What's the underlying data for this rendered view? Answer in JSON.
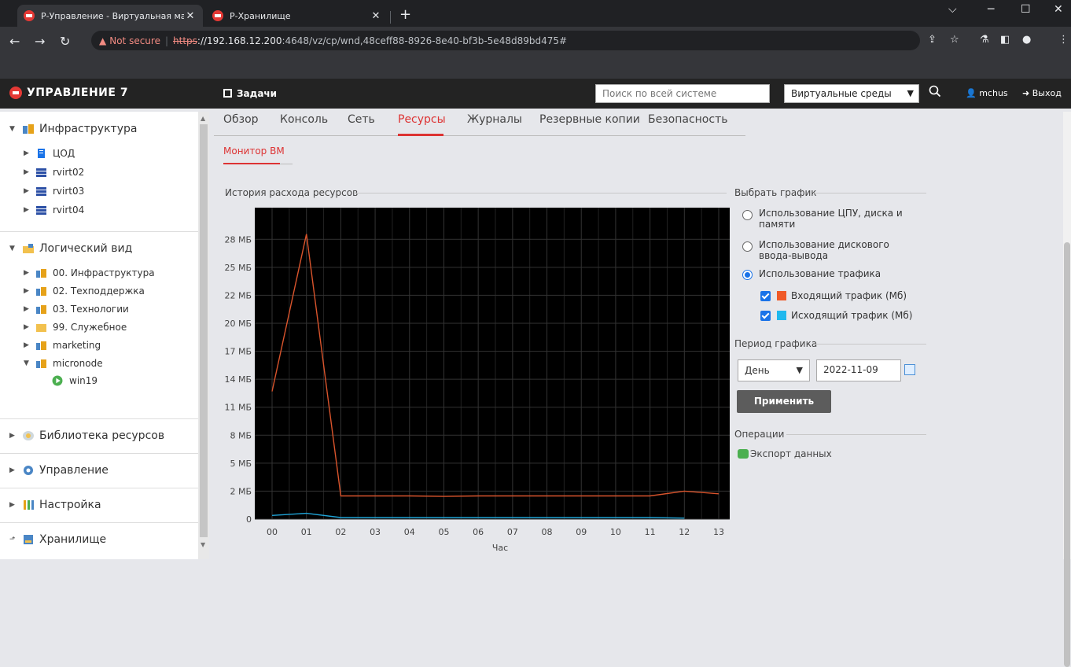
{
  "browser": {
    "tabs": [
      {
        "title": "Р-Управление - Виртуальная ма",
        "close": "✕"
      },
      {
        "title": "Р-Хранилище",
        "close": "✕"
      }
    ],
    "new_tab": "+",
    "url": {
      "warning_label": "Not secure",
      "protocol": "https",
      "host": "://192.168.12.200",
      "path": ":4648/vz/cp/wnd,48ceff88-8926-8e40-bf3b-5e48d89bd475#"
    }
  },
  "header": {
    "logo": "УПРАВЛЕНИЕ 7",
    "tasks_label": "Задачи",
    "search_placeholder": "Поиск по всей системе",
    "env_select": "Виртуальные среды",
    "user": "mchus",
    "logout": "Выход"
  },
  "sidebar": {
    "infrastructure": {
      "label": "Инфраструктура",
      "items": [
        "ЦОД",
        "rvirt02",
        "rvirt03",
        "rvirt04"
      ]
    },
    "logical": {
      "label": "Логический вид",
      "items": [
        "00. Инфраструктура",
        "02. Техподдержка",
        "03. Технологии",
        "99. Служебное",
        "marketing",
        "micronode"
      ],
      "child": "win19"
    },
    "library": "Библиотека ресурсов",
    "management": "Управление",
    "settings": "Настройка",
    "storage": "Хранилище"
  },
  "main": {
    "tabs": [
      "Обзор",
      "Консоль",
      "Сеть",
      "Ресурсы",
      "Журналы",
      "Резервные копии",
      "Безопасность"
    ],
    "active_tab": "Ресурсы",
    "subtab": "Монитор ВМ",
    "history_title": "История расхода ресурсов"
  },
  "chart_data": {
    "type": "line",
    "xlabel": "Час",
    "categories": [
      "00",
      "01",
      "02",
      "03",
      "04",
      "05",
      "06",
      "07",
      "08",
      "09",
      "10",
      "11",
      "12",
      "13"
    ],
    "y_ticks": [
      "0",
      "2 МБ",
      "5 МБ",
      "8 МБ",
      "11 МБ",
      "14 МБ",
      "17 МБ",
      "20 МБ",
      "22 МБ",
      "25 МБ",
      "28 МБ"
    ],
    "ylim": [
      0,
      29.5
    ],
    "grid": true,
    "series": [
      {
        "name": "Входящий трафик (Мб)",
        "color": "#d9542c",
        "values": [
          12.1,
          27.0,
          2.2,
          2.2,
          2.2,
          2.15,
          2.2,
          2.2,
          2.2,
          2.2,
          2.2,
          2.2,
          2.65,
          2.4
        ]
      },
      {
        "name": "Исходящий трафик (Мб)",
        "color": "#1fa3d6",
        "values": [
          0.35,
          0.55,
          0.15,
          0.15,
          0.15,
          0.15,
          0.15,
          0.15,
          0.15,
          0.15,
          0.15,
          0.15,
          0.1,
          null
        ]
      }
    ]
  },
  "controls": {
    "select_chart_label": "Выбрать график",
    "options": [
      {
        "label": "Использование ЦПУ, диска и памяти",
        "checked": false
      },
      {
        "label": "Использование дискового ввода-вывода",
        "checked": false
      },
      {
        "label": "Использование трафика",
        "checked": true
      }
    ],
    "series_toggles": [
      {
        "label": "Входящий трафик (Мб)",
        "color": "#f05a28",
        "checked": true
      },
      {
        "label": "Исходящий трафик (Мб)",
        "color": "#1fb8ee",
        "checked": true
      }
    ],
    "period_label": "Период графика",
    "period": "День",
    "date": "2022-11-09",
    "apply": "Применить",
    "operations_label": "Операции",
    "export": "Экспорт данных"
  }
}
